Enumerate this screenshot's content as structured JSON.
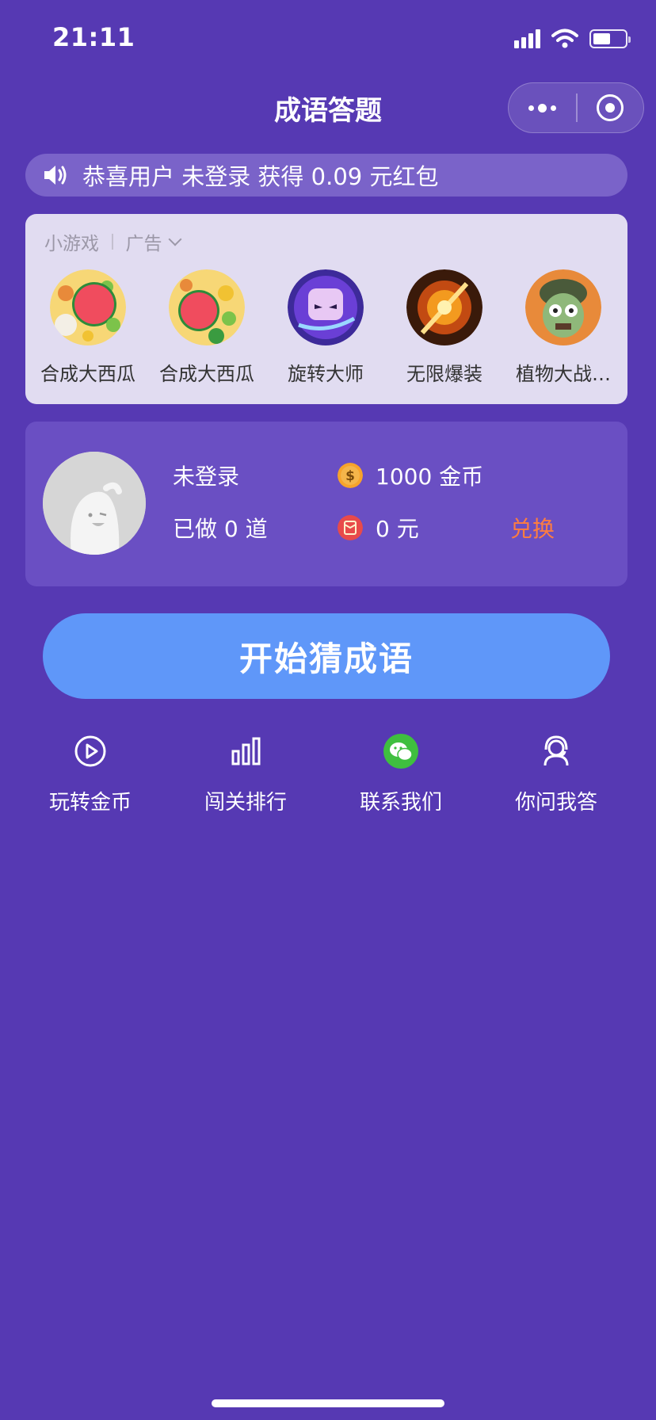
{
  "status_bar": {
    "time": "21:11",
    "battery_level": 0.55
  },
  "nav": {
    "title": "成语答题",
    "more_icon": "more-dots-icon",
    "close_icon": "target-icon"
  },
  "notice": {
    "icon": "speaker-icon",
    "text": "恭喜用户 未登录 获得 0.09 元红包"
  },
  "games": {
    "header_label": "小游戏",
    "ad_label": "广告",
    "items": [
      {
        "name": "合成大西瓜",
        "icon": "watermelon-icon"
      },
      {
        "name": "合成大西瓜",
        "icon": "watermelon-icon"
      },
      {
        "name": "旋转大师",
        "icon": "robot-icon"
      },
      {
        "name": "无限爆装",
        "icon": "fire-sword-icon"
      },
      {
        "name": "植物大战…",
        "icon": "zombie-icon"
      }
    ]
  },
  "user": {
    "login_status": "未登录",
    "coins": "1000 金币",
    "done": "已做 0 道",
    "money": "0 元",
    "exchange_label": "兑换"
  },
  "start_button": {
    "label": "开始猜成语"
  },
  "menu": [
    {
      "label": "玩转金币",
      "icon": "play-circle-icon"
    },
    {
      "label": "闯关排行",
      "icon": "bar-chart-icon"
    },
    {
      "label": "联系我们",
      "icon": "wechat-icon"
    },
    {
      "label": "你问我答",
      "icon": "customer-service-icon"
    }
  ],
  "colors": {
    "background": "#5639b3",
    "accent_blue": "#5f97f9",
    "exchange_orange": "#ff7d3f",
    "wechat_green": "#3fbf3f"
  }
}
